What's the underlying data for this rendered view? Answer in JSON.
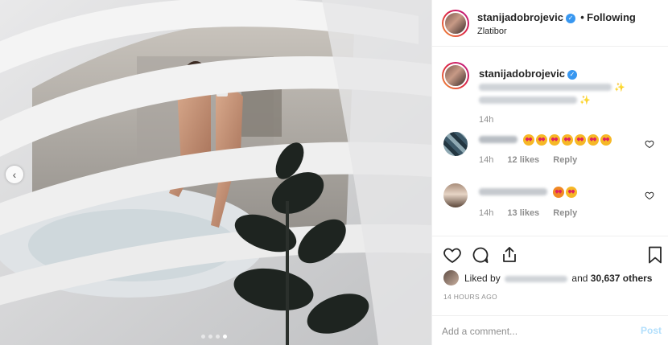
{
  "post": {
    "username": "stanijadobrojevic",
    "verified_icon": "check-icon",
    "follow_separator": "•",
    "follow_label": "Following",
    "location": "Zlatibor",
    "caption_author": "stanijadobrojevic",
    "comments": [
      {
        "time": "14h",
        "likes": "12 likes",
        "reply": "Reply",
        "emoji_text": ""
      },
      {
        "time": "14h",
        "likes": "13 likes",
        "reply": "Reply",
        "emoji_text": ""
      }
    ],
    "caption_time": "14h",
    "liked_by_prefix": "Liked by",
    "liked_by_suffix": "and",
    "liked_count_text": "30,637 others",
    "posted_ago": "14 HOURS AGO",
    "comment_placeholder": "Add a comment...",
    "post_button": "Post",
    "carousel_prev_icon": "chevron-left-icon",
    "carousel_dots": 4,
    "carousel_active_index": 3
  },
  "colors": {
    "verified": "#3897f0",
    "post_button_disabled": "#b2dffc",
    "meta_text": "#8e8e8e"
  }
}
